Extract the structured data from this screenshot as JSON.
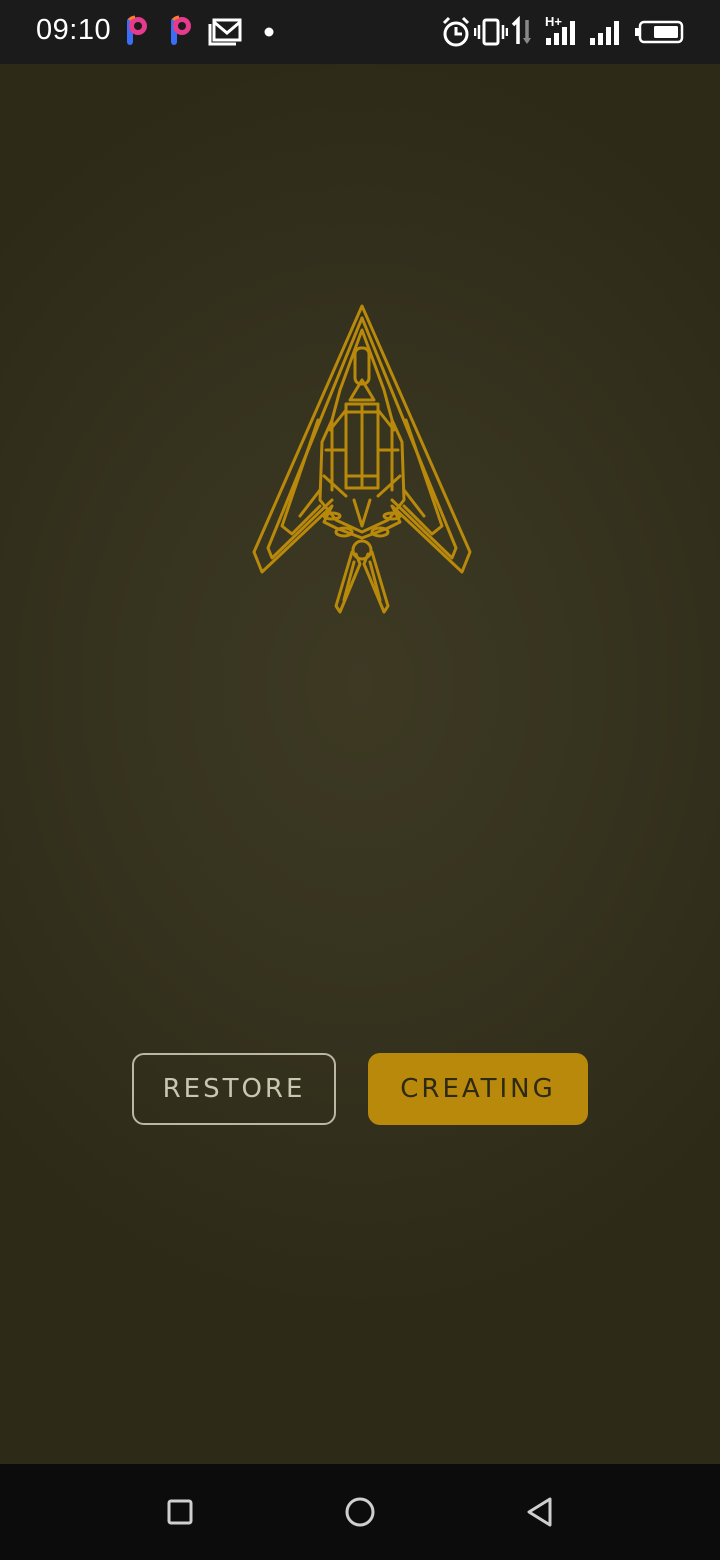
{
  "status_bar": {
    "time": "09:10",
    "network_label": "H+",
    "icons": [
      "picsart-icon",
      "picsart-icon",
      "gallery-mail-icon",
      "notification-dot-icon",
      "alarm-icon",
      "vibrate-icon",
      "data-transfer-icon",
      "signal-icon",
      "signal-icon",
      "battery-icon"
    ]
  },
  "main": {
    "logo": "stealth-jet-icon",
    "accent_color": "#b8890b",
    "restore_label": "RESTORE",
    "creating_label": "CREATING"
  },
  "nav_bar": {
    "items": [
      "recents-button",
      "home-button",
      "back-button"
    ]
  }
}
